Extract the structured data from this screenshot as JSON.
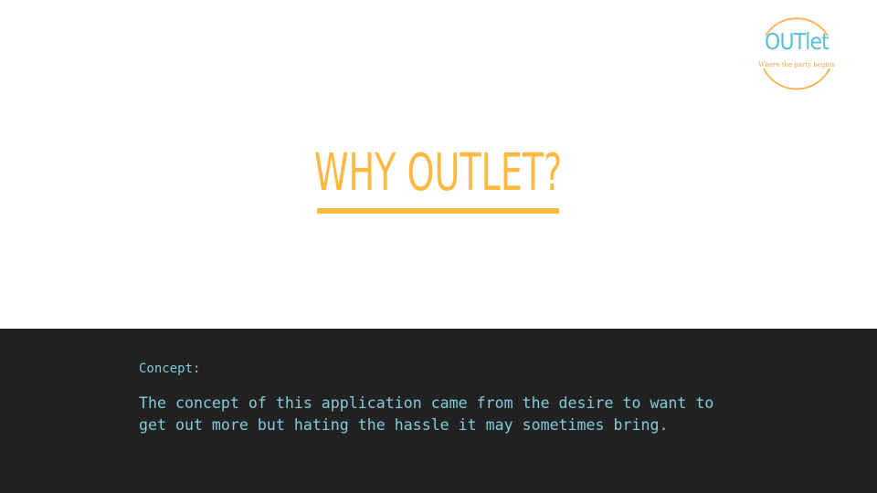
{
  "slide": {
    "title": "WHY OUTLET?",
    "concept_label": "Concept:",
    "concept_text": "The concept of this application came from the desire to want to get out more but hating the hassle it may sometimes bring."
  },
  "logo": {
    "word": "OUTlet",
    "tagline": "Where the party begins",
    "ring_color": "#f8b45a",
    "word_color": "#5bbfd6",
    "tagline_color": "#f5a64a"
  },
  "colors": {
    "title": "#ffb842",
    "dark_panel": "#212121",
    "body_text": "#7fcbd8",
    "background": "#ffffff"
  }
}
